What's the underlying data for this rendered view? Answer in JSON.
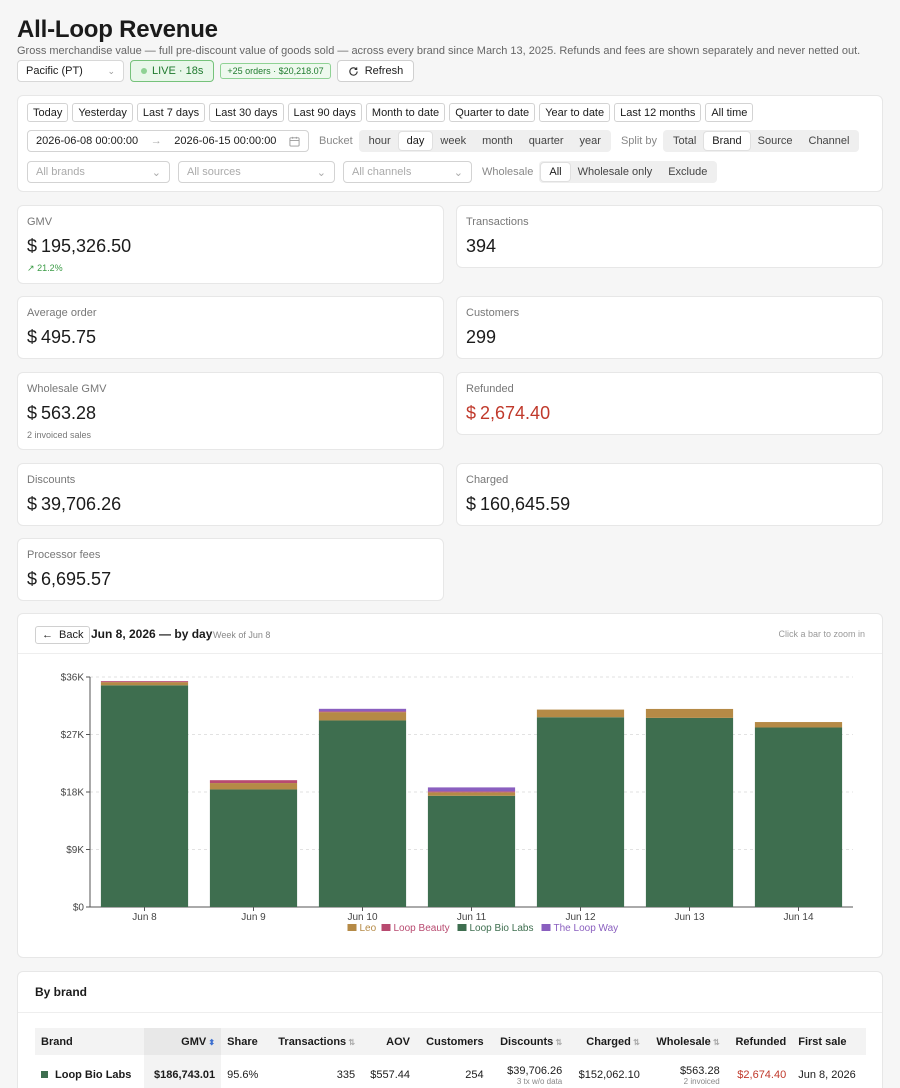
{
  "header": {
    "title": "All-Loop Revenue",
    "subtitle": "Gross merchandise value — full pre-discount value of goods sold — across every brand since March 13, 2025. Refunds and fees are shown separately and never netted out.",
    "timezone": "Pacific (PT)",
    "live_label": "LIVE · 18s",
    "new_orders": "+25 orders · $20,218.07",
    "refresh_label": "Refresh"
  },
  "ranges": [
    "Today",
    "Yesterday",
    "Last 7 days",
    "Last 30 days",
    "Last 90 days",
    "Month to date",
    "Quarter to date",
    "Year to date",
    "Last 12 months",
    "All time"
  ],
  "date_from": "2026-06-08 00:00:00",
  "date_to": "2026-06-15 00:00:00",
  "bucket_label": "Bucket",
  "buckets": [
    "hour",
    "day",
    "week",
    "month",
    "quarter",
    "year"
  ],
  "bucket_selected": "day",
  "split_label": "Split by",
  "splits": [
    "Total",
    "Brand",
    "Source",
    "Channel"
  ],
  "split_selected": "Brand",
  "filters": {
    "brands": "All brands",
    "sources": "All sources",
    "channels": "All channels"
  },
  "wholesale_label": "Wholesale",
  "wholesale_options": [
    "All",
    "Wholesale only",
    "Exclude"
  ],
  "wholesale_selected": "All",
  "stats": {
    "gmv": {
      "label": "GMV",
      "currency": "$",
      "value": "195,326.50",
      "delta": "21.2%"
    },
    "transactions": {
      "label": "Transactions",
      "value": "394"
    },
    "aov": {
      "label": "Average order",
      "currency": "$",
      "value": "495.75"
    },
    "customers": {
      "label": "Customers",
      "value": "299"
    },
    "wholesale": {
      "label": "Wholesale GMV",
      "currency": "$",
      "value": "563.28",
      "note": "2 invoiced sales"
    },
    "refunded": {
      "label": "Refunded",
      "currency": "$",
      "value": "2,674.40"
    },
    "discounts": {
      "label": "Discounts",
      "currency": "$",
      "value": "39,706.26"
    },
    "charged": {
      "label": "Charged",
      "currency": "$",
      "value": "160,645.59"
    },
    "fees": {
      "label": "Processor fees",
      "currency": "$",
      "value": "6,695.57"
    }
  },
  "chart": {
    "back_label": "Back",
    "title": "Jun 8, 2026 — by day",
    "sub": "Week of Jun 8",
    "hint": "Click a bar to zoom in"
  },
  "chart_data": {
    "type": "bar",
    "stacked": true,
    "categories": [
      "Jun 8",
      "Jun 9",
      "Jun 10",
      "Jun 11",
      "Jun 12",
      "Jun 13",
      "Jun 14"
    ],
    "series": [
      {
        "name": "Loop Bio Labs",
        "color": "#3e6e4f",
        "values": [
          34700,
          18400,
          29200,
          17400,
          29700,
          29600,
          28100
        ]
      },
      {
        "name": "Leo",
        "color": "#b58a46",
        "values": [
          500,
          1000,
          1300,
          550,
          1200,
          1400,
          850
        ]
      },
      {
        "name": "Loop Beauty",
        "color": "#b84a70",
        "values": [
          150,
          450,
          120,
          150,
          0,
          0,
          0
        ]
      },
      {
        "name": "The Loop Way",
        "color": "#8a5fbf",
        "values": [
          0,
          0,
          400,
          620,
          0,
          0,
          0
        ]
      }
    ],
    "legend_order": [
      "Leo",
      "Loop Beauty",
      "Loop Bio Labs",
      "The Loop Way"
    ],
    "yticks": [
      "$36K",
      "$27K",
      "$18K",
      "$9K",
      "$0"
    ],
    "ylim": [
      0,
      36000
    ],
    "grid": true,
    "legend_position": "bottom"
  },
  "brand_table": {
    "title": "By brand",
    "columns": [
      "Brand",
      "GMV",
      "Share",
      "Transactions",
      "AOV",
      "Customers",
      "Discounts",
      "Charged",
      "Wholesale",
      "Refunded",
      "First sale"
    ],
    "rows": [
      {
        "brand": "Loop Bio Labs",
        "gmv": "$186,743.01",
        "share": "95.6%",
        "transactions": "335",
        "aov": "$557.44",
        "customers": "254",
        "discounts": "$39,706.26",
        "discounts_note": "3 tx w/o data",
        "charged": "$152,062.10",
        "wholesale": "$563.28",
        "wholesale_note": "2 invoiced",
        "refunded": "$2,674.40",
        "first_sale": "Jun 8, 2026"
      }
    ]
  }
}
